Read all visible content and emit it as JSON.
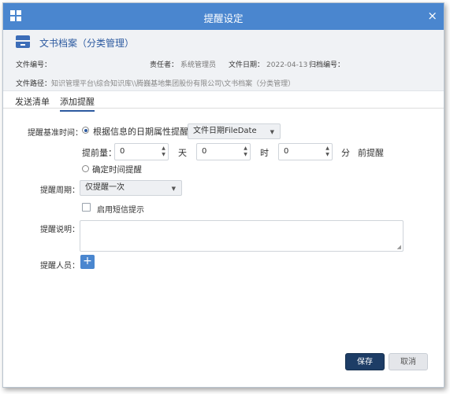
{
  "window": {
    "title": "提醒设定",
    "close_glyph": "×"
  },
  "header": {
    "doc_title": "文书档案（分类管理）",
    "file_number_label": "文件编号：",
    "file_number_value": "",
    "owner_label": "责任者：",
    "owner_value": "系统管理员",
    "file_date_label": "文件日期：",
    "file_date_value": "2022-04-13",
    "archive_number_label": "归档编号：",
    "archive_number_value": "",
    "path_label": "文件路径：",
    "path_value": "知识管理平台\\综合知识库\\\\腾巍基地集团股份有限公司\\文书档案（分类管理）"
  },
  "tabs": [
    {
      "label": "发送清单",
      "active": false
    },
    {
      "label": "添加提醒",
      "active": true
    }
  ],
  "form": {
    "base_time_label": "提醒基准时间：",
    "option_date_attr_label": "根据信息的日期属性提醒：",
    "option_date_attr_selected": true,
    "date_attr_select_value": "文件日期FileDate",
    "advance_label": "提前量：",
    "days_value": "0",
    "days_unit": "天",
    "hours_value": "0",
    "hours_unit": "时",
    "minutes_value": "0",
    "minutes_unit": "分",
    "advance_suffix": "前提醒",
    "option_fixed_time_label": "确定时间提醒",
    "option_fixed_time_selected": false,
    "period_label": "提醒周期：",
    "period_select_value": "仅提醒一次",
    "sms_label": "启用短信提示",
    "sms_checked": false,
    "description_label": "提醒说明：",
    "description_value": "",
    "recipients_label": "提醒人员：",
    "add_glyph": "+"
  },
  "buttons": {
    "save": "保存",
    "cancel": "取消"
  },
  "icons": {
    "caret": "▼",
    "spin_up": "▲",
    "spin_down": "▼",
    "resize_grip": "◢"
  },
  "colors": {
    "titlebar": "#4a86cf",
    "accent": "#2c5aa0",
    "save_button": "#1d3d66"
  }
}
